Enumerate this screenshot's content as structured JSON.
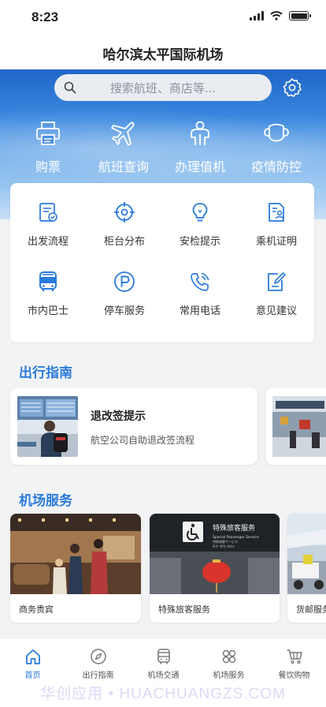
{
  "status": {
    "time": "8:23"
  },
  "header": {
    "title": "哈尔滨太平国际机场"
  },
  "search": {
    "placeholder": "搜索航班、商店等..."
  },
  "quick_actions": [
    {
      "label": "购票",
      "icon": "printer-icon"
    },
    {
      "label": "航班查询",
      "icon": "airplane-icon"
    },
    {
      "label": "办理值机",
      "icon": "person-icon"
    },
    {
      "label": "疫情防控",
      "icon": "mask-icon"
    }
  ],
  "grid": [
    {
      "label": "出发流程",
      "icon": "checklist-icon"
    },
    {
      "label": "柜台分布",
      "icon": "crosshair-icon"
    },
    {
      "label": "安检提示",
      "icon": "lightbulb-icon"
    },
    {
      "label": "乘机证明",
      "icon": "document-person-icon"
    },
    {
      "label": "市内巴士",
      "icon": "bus-icon"
    },
    {
      "label": "停车服务",
      "icon": "parking-icon"
    },
    {
      "label": "常用电话",
      "icon": "phone-icon"
    },
    {
      "label": "意见建议",
      "icon": "edit-icon"
    }
  ],
  "guide": {
    "title": "出行指南",
    "cards": [
      {
        "title": "退改签提示",
        "subtitle": "航空公司自助退改签流程"
      }
    ]
  },
  "services": {
    "title": "机场服务",
    "cards": [
      {
        "label": "商务贵宾"
      },
      {
        "label": "特殊旅客服务",
        "sign_title": "特殊旅客服务",
        "sign_en": "Special Passenger Service",
        "sign_jp": "特殊旅客サービス",
        "sign_kr": "특수 여객 서비스"
      },
      {
        "label": "货邮服务"
      }
    ]
  },
  "tabs": [
    {
      "label": "首页",
      "icon": "home-icon",
      "active": true
    },
    {
      "label": "出行指南",
      "icon": "compass-icon",
      "active": false
    },
    {
      "label": "机场交通",
      "icon": "bus-tab-icon",
      "active": false
    },
    {
      "label": "机场服务",
      "icon": "services-grid-icon",
      "active": false
    },
    {
      "label": "餐饮购物",
      "icon": "cart-icon",
      "active": false
    }
  ],
  "watermark": "华创应用 • HUACHUANGZS.COM",
  "colors": {
    "accent": "#2b7bdc",
    "hero_top": "#1f66c8"
  }
}
